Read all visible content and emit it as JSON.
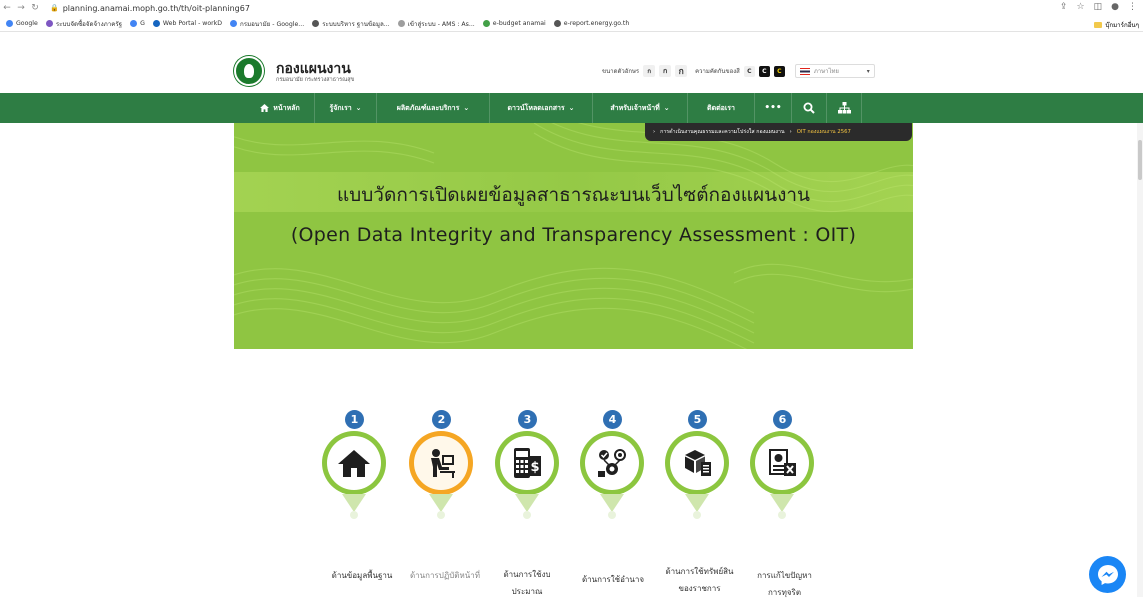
{
  "browser": {
    "url": "planning.anamai.moph.go.th/th/oit-planning67",
    "bookmarks": [
      {
        "label": "Google",
        "color": "#4285f4"
      },
      {
        "label": "ระบบจัดซื้อจัดจ้างภาครัฐ",
        "color": "#7e57c2"
      },
      {
        "label": "G",
        "color": "#4285f4"
      },
      {
        "label": "Web Portal - workD",
        "color": "#1565c0"
      },
      {
        "label": "กรมอนามัย - Google...",
        "color": "#4285f4"
      },
      {
        "label": "ระบบบริหาร ฐานข้อมูล...",
        "color": "#555555"
      },
      {
        "label": "เข้าสู่ระบบ - AMS : As...",
        "color": "#9e9e9e"
      },
      {
        "label": "e-budget anamai",
        "color": "#43a047"
      },
      {
        "label": "e-report.energy.go.th",
        "color": "#555555"
      }
    ],
    "bookmarks_right": "บุ๊กมาร์กอื่นๆ"
  },
  "header": {
    "title": "กองแผนงาน",
    "subtitle": "กรมอนามัย กระทรวงสาธารณสุข",
    "font_size_label": "ขนาดตัวอักษร",
    "font_buttons": [
      "ก",
      "ก",
      "ก"
    ],
    "contrast_label": "ความคัดกันของสี",
    "contrast_buttons": [
      "C",
      "C",
      "C"
    ],
    "language": "ภาษาไทย"
  },
  "nav": {
    "items": [
      {
        "label": "หน้าหลัก",
        "icon": "home-icon"
      },
      {
        "label": "รู้จักเรา",
        "dropdown": true
      },
      {
        "label": "ผลิตภัณฑ์และบริการ",
        "dropdown": true
      },
      {
        "label": "ดาวน์โหลดเอกสาร",
        "dropdown": true
      },
      {
        "label": "สำหรับเจ้าหน้าที่",
        "dropdown": true
      },
      {
        "label": "ติดต่อเรา"
      }
    ],
    "more_label": "•••"
  },
  "breadcrumb": {
    "items": [
      "การดำเนินงานคุณธรรมและความโปร่งใส กองแผนงาน",
      "OIT กองแผนงาน 2567"
    ]
  },
  "banner": {
    "title": "แบบวัดการเปิดเผยข้อมูลสาธารณะบนเว็บไซต์กองแผนงาน",
    "subtitle": "(Open Data Integrity and Transparency Assessment : OIT)"
  },
  "cards": [
    {
      "number": "1",
      "label": "ด้านข้อมูลพื้นฐาน",
      "icon": "house-icon"
    },
    {
      "number": "2",
      "label": "ด้านการปฏิบัติหน้าที่",
      "icon": "worker-desk-icon"
    },
    {
      "number": "3",
      "label_lines": [
        "ด้านการใช้งบ",
        "ประมาณ"
      ],
      "icon": "calculator-money-icon"
    },
    {
      "number": "4",
      "label": "ด้านการใช้อำนาจ",
      "icon": "authority-icon"
    },
    {
      "number": "5",
      "label_lines": [
        "ด้านการใช้ทรัพย์สิน",
        "ของราชการ"
      ],
      "icon": "assets-boxes-icon"
    },
    {
      "number": "6",
      "label_lines": [
        "การแก้ไขปัญหา",
        "การทุจริต"
      ],
      "icon": "fraud-document-icon"
    }
  ]
}
